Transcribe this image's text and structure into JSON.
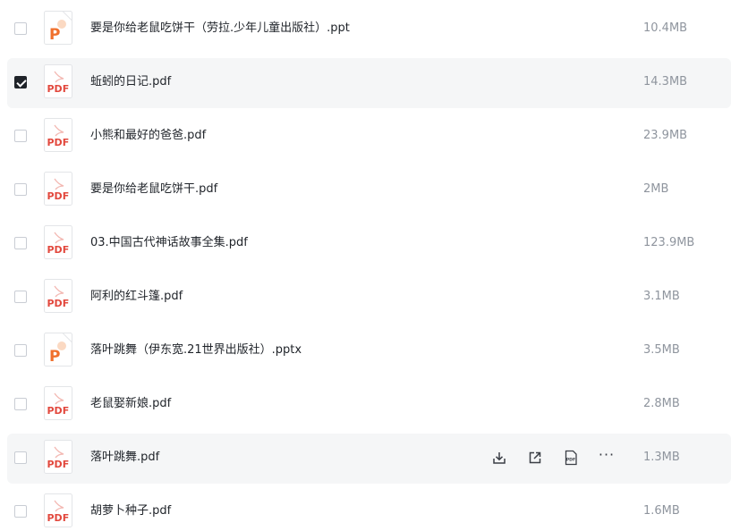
{
  "files": [
    {
      "name": "要是你给老鼠吃饼干（劳拉.少年儿童出版社）.ppt",
      "size": "10.4MB",
      "type": "ppt",
      "icon": "ppt-file-icon",
      "checked": false
    },
    {
      "name": "蚯蚓的日记.pdf",
      "size": "14.3MB",
      "type": "pdf",
      "icon": "pdf-file-icon",
      "checked": true
    },
    {
      "name": "小熊和最好的爸爸.pdf",
      "size": "23.9MB",
      "type": "pdf",
      "icon": "pdf-file-icon",
      "checked": false
    },
    {
      "name": "要是你给老鼠吃饼干.pdf",
      "size": "2MB",
      "type": "pdf",
      "icon": "pdf-file-icon",
      "checked": false
    },
    {
      "name": "03.中国古代神话故事全集.pdf",
      "size": "123.9MB",
      "type": "pdf",
      "icon": "pdf-file-icon",
      "checked": false
    },
    {
      "name": "阿利的红斗篷.pdf",
      "size": "3.1MB",
      "type": "pdf",
      "icon": "pdf-file-icon",
      "checked": false
    },
    {
      "name": "落叶跳舞（伊东宽.21世界出版社）.pptx",
      "size": "3.5MB",
      "type": "ppt",
      "icon": "ppt-file-icon",
      "checked": false
    },
    {
      "name": "老鼠娶新娘.pdf",
      "size": "2.8MB",
      "type": "pdf",
      "icon": "pdf-file-icon",
      "checked": false
    },
    {
      "name": "落叶跳舞.pdf",
      "size": "1.3MB",
      "type": "pdf",
      "icon": "pdf-file-icon",
      "checked": false
    },
    {
      "name": "胡萝卜种子.pdf",
      "size": "1.6MB",
      "type": "pdf",
      "icon": "pdf-file-icon",
      "checked": false
    }
  ],
  "icon_labels": {
    "pdf": "PDF",
    "ppt": "P",
    "pdf_small": "PDF"
  },
  "row_actions": {
    "download_icon": "download-icon",
    "share_icon": "share-icon",
    "pdf_icon": "pdf-convert-icon",
    "more_label": "···"
  },
  "colors": {
    "pdf_red": "#e2483d",
    "ppt_orange": "#f0702d",
    "selected_bg": "#f5f6f7",
    "size_gray": "#8f959e"
  }
}
